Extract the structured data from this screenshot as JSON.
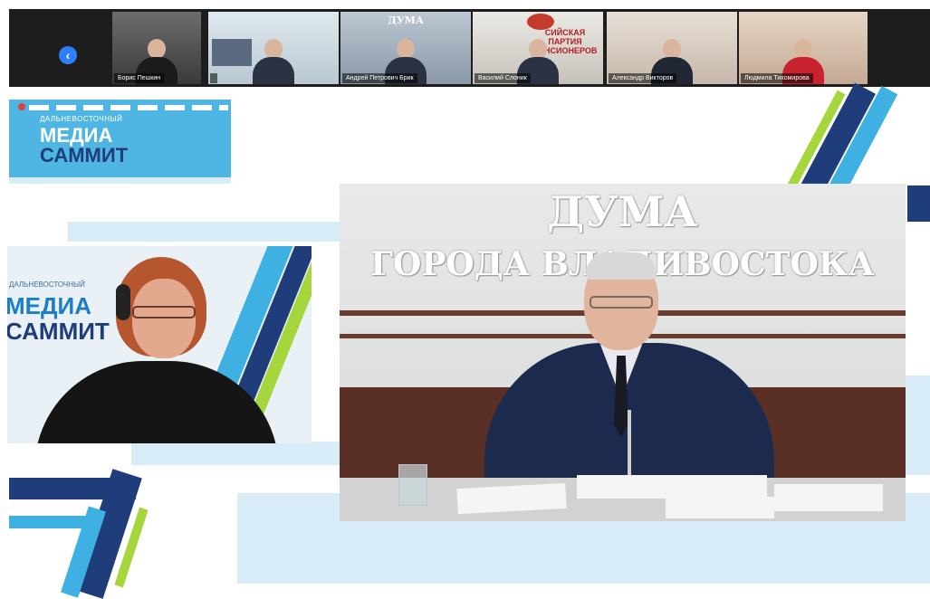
{
  "window": {
    "back_button_glyph": "‹"
  },
  "participants": [
    {
      "name": "Борис Пешкин"
    },
    {
      "name": ""
    },
    {
      "name": "Андрей Петрович Брик"
    },
    {
      "name": "Василий Слоник"
    },
    {
      "name": "Александр Викторов"
    },
    {
      "name": "Людмила Тихомирова"
    }
  ],
  "thumb_signs": {
    "duma_small": "ДУМА",
    "party": "СИЙСКАЯ ПАРТИЯ ПЕНСИОНЕРОВ"
  },
  "logo": {
    "small": "ДАЛЬНЕВОСТОЧНЫЙ",
    "line1": "МЕДИА",
    "line2": "САММИТ"
  },
  "left_tile": {
    "logo_small": "ДАЛЬНЕВОСТОЧНЫЙ",
    "logo_line1": "МЕДИА",
    "logo_line2": "САММИТ"
  },
  "main_tile": {
    "sign_line1": "ДУМА",
    "sign_line2": "ГОРОДА ВЛАДИВОСТОКА"
  },
  "colors": {
    "brand_light_blue": "#4fb6e4",
    "brand_navy": "#1e3d7a",
    "brand_green": "#a5d63b",
    "band_light": "#d7ecf7"
  }
}
